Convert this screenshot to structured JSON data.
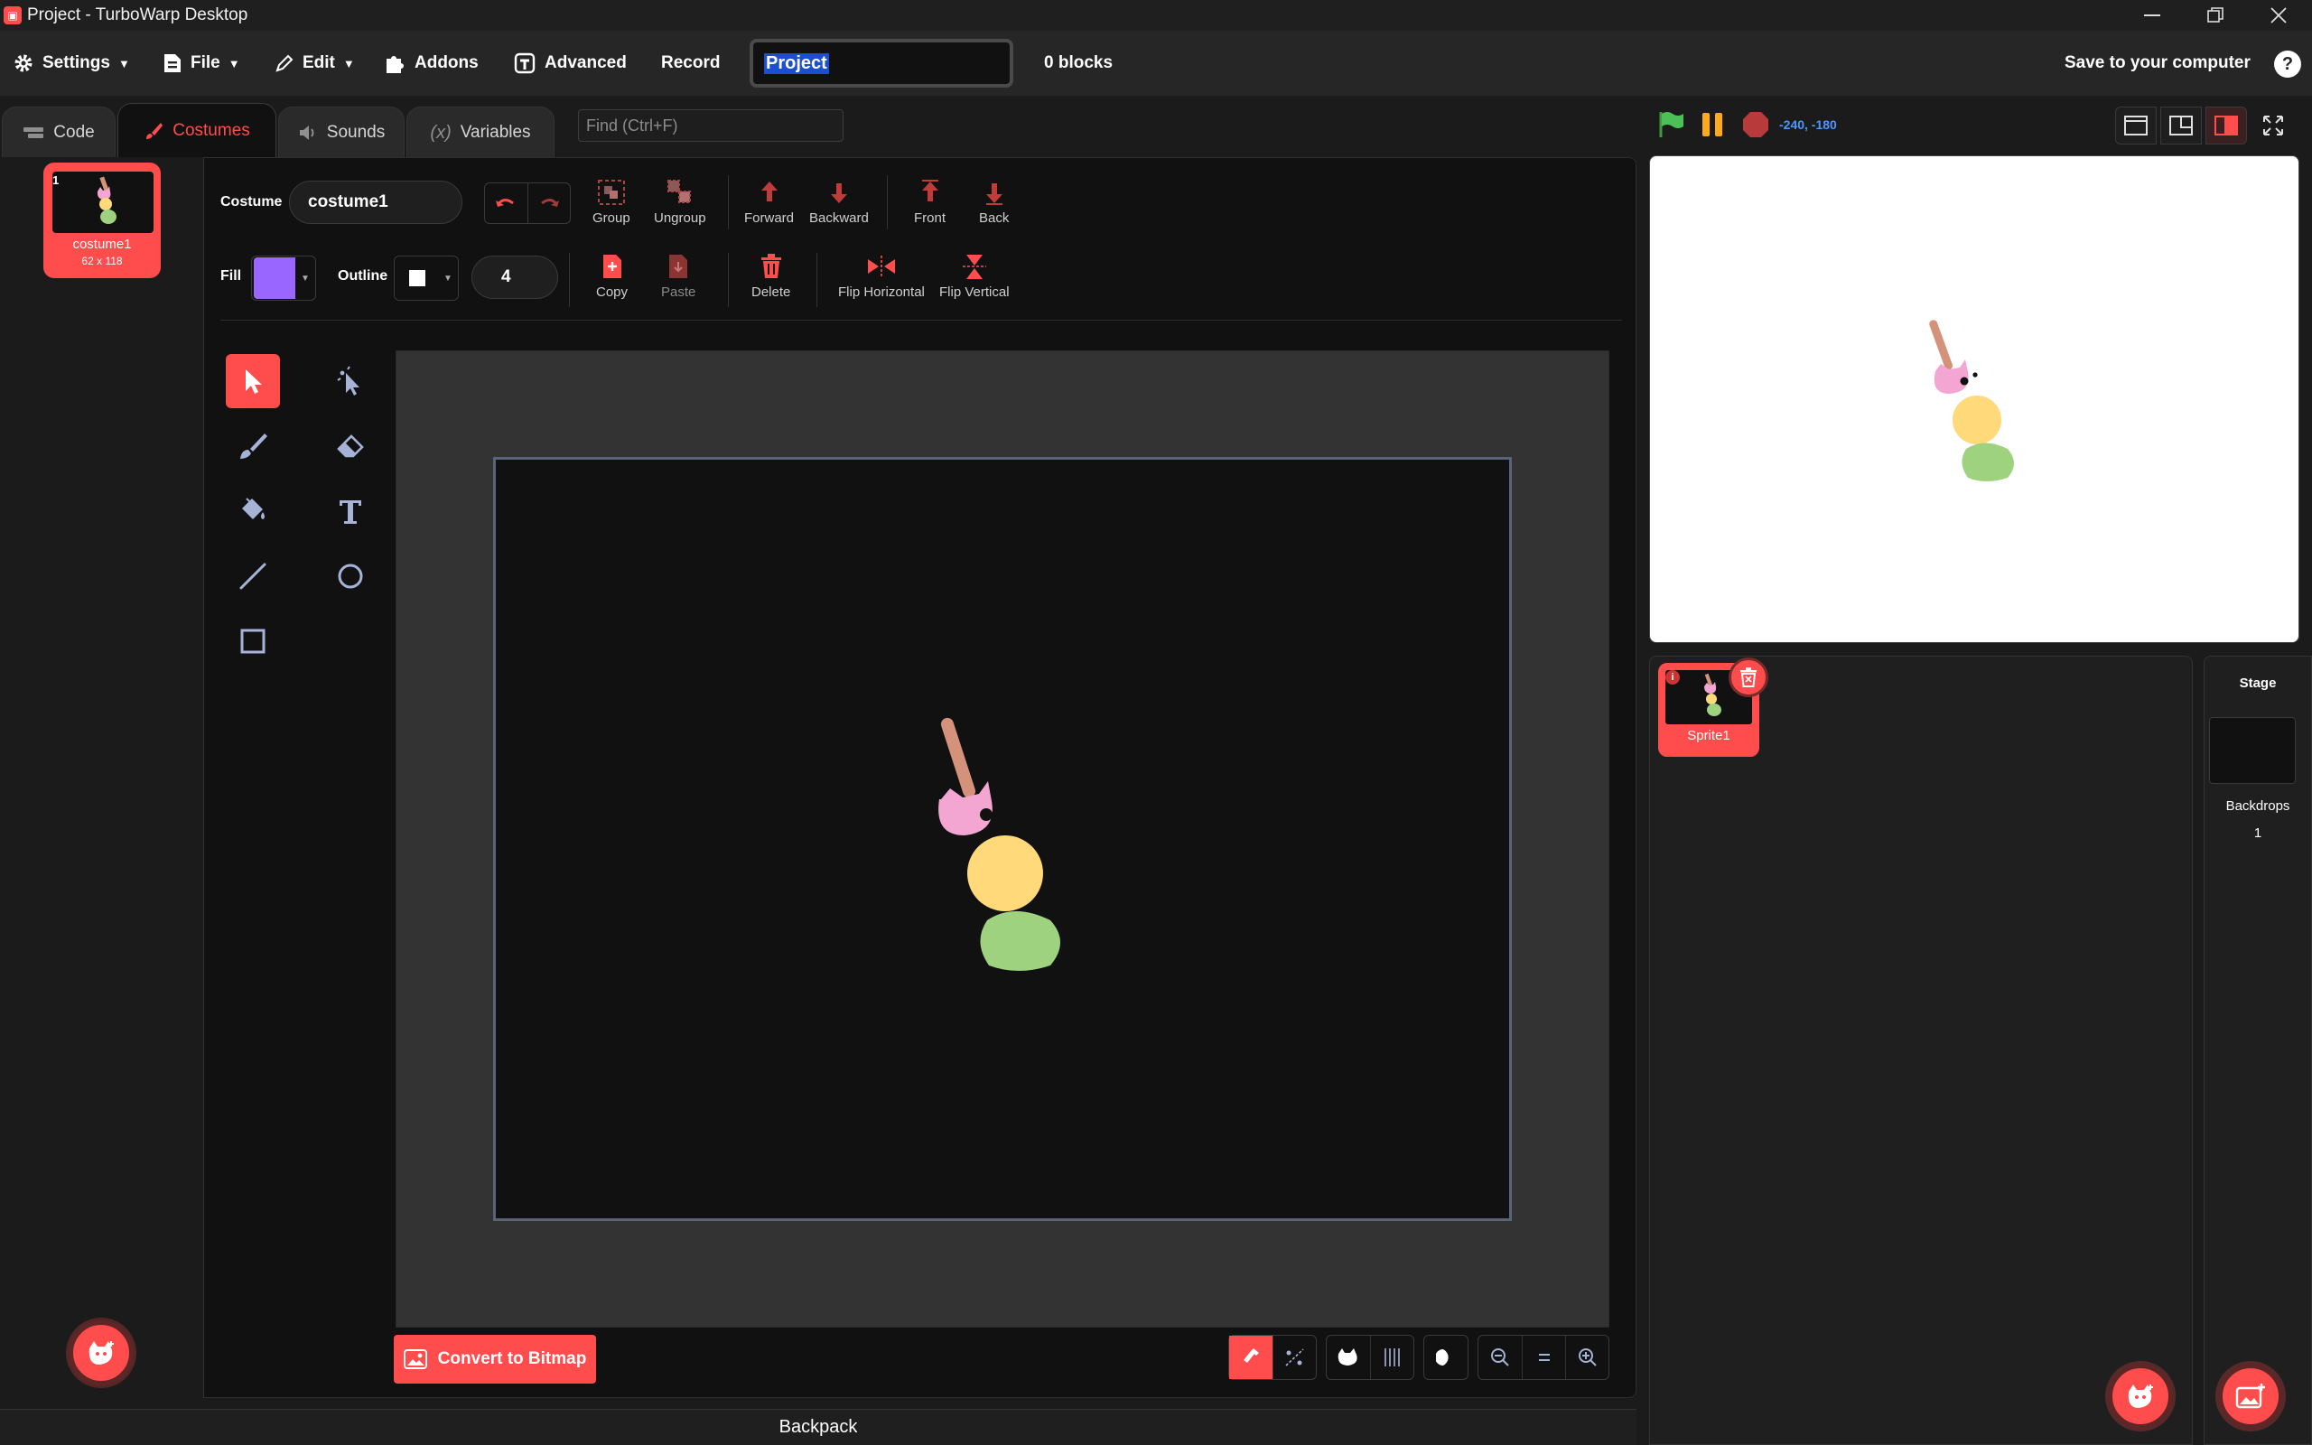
{
  "window": {
    "title": "Project - TurboWarp Desktop"
  },
  "menubar": {
    "settings": "Settings",
    "file": "File",
    "edit": "Edit",
    "addons": "Addons",
    "advanced": "Advanced",
    "record": "Record",
    "project_title": "Project",
    "block_count": "0 blocks",
    "save": "Save to your computer",
    "help": "?"
  },
  "tabs": [
    {
      "label": "Code",
      "icon": "code-icon"
    },
    {
      "label": "Costumes",
      "icon": "brush-icon",
      "active": true
    },
    {
      "label": "Sounds",
      "icon": "speaker-icon"
    },
    {
      "label": "Variables",
      "icon": "variable-icon"
    }
  ],
  "find": {
    "placeholder": "Find (Ctrl+F)"
  },
  "costumes": [
    {
      "number": "1",
      "name": "costume1",
      "size": "62 x 118"
    }
  ],
  "paint": {
    "costume_label": "Costume",
    "costume_name": "costume1",
    "fill_label": "Fill",
    "fill_color": "#9966ff",
    "outline_label": "Outline",
    "outline_color": "#ffffff",
    "outline_width": "4",
    "group": "Group",
    "ungroup": "Ungroup",
    "forward": "Forward",
    "backward": "Backward",
    "front": "Front",
    "back": "Back",
    "copy": "Copy",
    "paste": "Paste",
    "delete": "Delete",
    "flip_horizontal": "Flip Horizontal",
    "flip_vertical": "Flip Vertical",
    "convert": "Convert to Bitmap"
  },
  "stage_header": {
    "coordinates": "-240, -180"
  },
  "sprites": [
    {
      "name": "Sprite1"
    }
  ],
  "stage_panel": {
    "label": "Stage",
    "backdrops_label": "Backdrops",
    "backdrops_count": "1"
  },
  "backpack": "Backpack",
  "colors": {
    "accent": "#ff4c4c",
    "background": "#111111",
    "panel": "#1f1f1f",
    "coordinates": "#4c97ff",
    "green_flag": "#4cbf56",
    "pause": "#ffab19"
  }
}
